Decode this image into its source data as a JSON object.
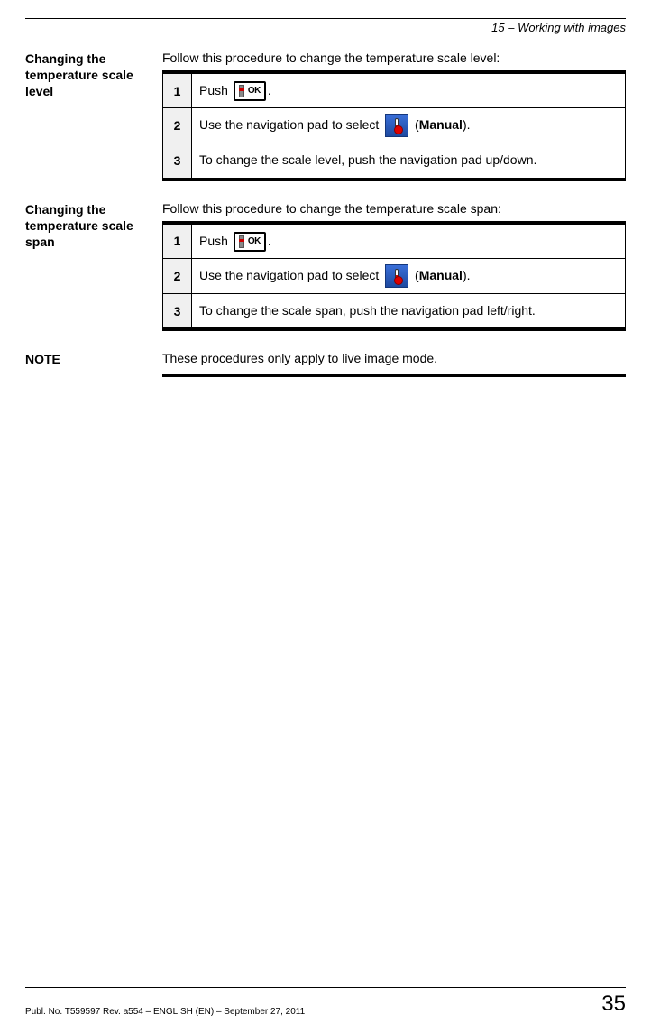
{
  "header": {
    "chapter": "15 – Working with images"
  },
  "sections": [
    {
      "sidebar": "Changing the temperature scale level",
      "intro": "Follow this procedure to change the temperature scale level:",
      "steps": [
        {
          "num": "1",
          "pre": "Push ",
          "icon": "ok",
          "post": "."
        },
        {
          "num": "2",
          "pre": "Use the navigation pad to select ",
          "icon": "manual",
          "post": " (",
          "bold": "Manual",
          "post2": ")."
        },
        {
          "num": "3",
          "text": "To change the scale level, push the navigation pad up/down."
        }
      ]
    },
    {
      "sidebar": "Changing the temperature scale span",
      "intro": "Follow this procedure to change the temperature scale span:",
      "steps": [
        {
          "num": "1",
          "pre": "Push ",
          "icon": "ok",
          "post": "."
        },
        {
          "num": "2",
          "pre": "Use the navigation pad to select ",
          "icon": "manual",
          "post": " (",
          "bold": "Manual",
          "post2": ")."
        },
        {
          "num": "3",
          "text": "To change the scale span, push the navigation pad left/right."
        }
      ]
    }
  ],
  "note": {
    "label": "NOTE",
    "text": "These procedures only apply to live image mode."
  },
  "footer": {
    "left": "Publ. No. T559597 Rev. a554 – ENGLISH (EN) – September 27, 2011",
    "page": "35"
  },
  "icons": {
    "ok_label": "OK"
  }
}
